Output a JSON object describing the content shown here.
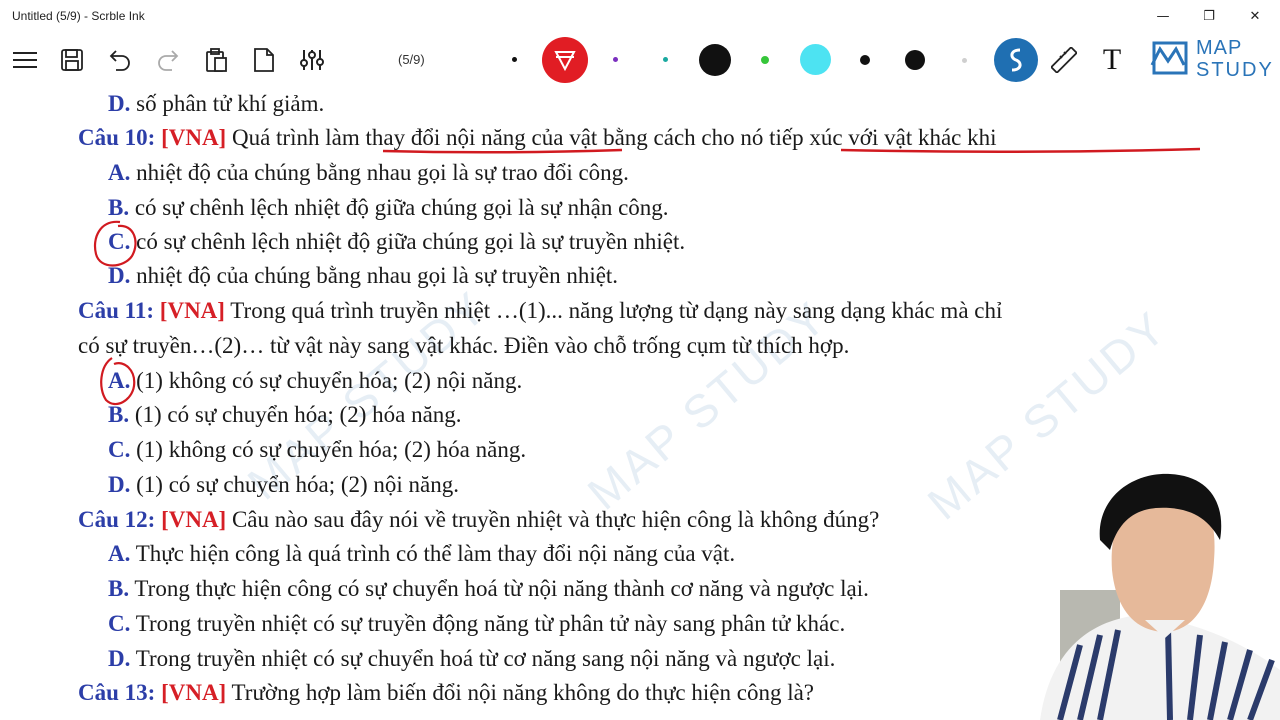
{
  "window": {
    "title": "Untitled (5/9) - Scrble Ink"
  },
  "window_controls": {
    "minimize": "—",
    "maximize": "❐",
    "close": "✕"
  },
  "toolbar": {
    "page_indicator": "(5/9)",
    "text_tool": "T",
    "colors": {
      "red": "#e11d24",
      "purple": "#7b2fbf",
      "teal": "#1aa9a0",
      "black": "#111111",
      "green": "#36c63a",
      "cyan": "#4de3f2",
      "gray": "#cfcfcf",
      "brand_blue": "#1f6fb2"
    }
  },
  "logo": {
    "line1": "MAP",
    "line2": "STUDY"
  },
  "watermark": "MAP STUDY",
  "doc": {
    "prev_d": {
      "label": "D.",
      "text": " số phân tử khí giảm."
    },
    "q10": {
      "label": "Câu 10:",
      "tag": "[VNA]",
      "text": " Quá trình làm thay đổi nội năng của vật bằng cách cho nó tiếp xúc với vật khác khi",
      "options": [
        {
          "label": "A.",
          "text": " nhiệt độ của chúng bằng nhau gọi là sự trao đổi công."
        },
        {
          "label": "B.",
          "text": " có sự chênh lệch nhiệt độ giữa chúng gọi là sự nhận công."
        },
        {
          "label": "C.",
          "text": " có sự chênh lệch nhiệt độ giữa chúng gọi là sự truyền nhiệt."
        },
        {
          "label": "D.",
          "text": " nhiệt độ của chúng bằng nhau gọi là sự truyền nhiệt."
        }
      ]
    },
    "q11": {
      "label": "Câu 11:",
      "tag": "[VNA]",
      "text": " Trong quá trình truyền nhiệt …(1)... năng lượng từ dạng này sang dạng khác mà chỉ",
      "text2": "có sự truyền…(2)… từ vật này sang vật khác. Điền vào chỗ trống cụm từ thích hợp.",
      "options": [
        {
          "label": "A.",
          "text": " (1) không có sự chuyển hóa; (2) nội năng."
        },
        {
          "label": "B.",
          "text": " (1) có sự chuyển hóa; (2) hóa năng."
        },
        {
          "label": "C.",
          "text": " (1) không có sự chuyển hóa; (2) hóa năng."
        },
        {
          "label": "D.",
          "text": " (1) có sự chuyển hóa; (2) nội năng."
        }
      ]
    },
    "q12": {
      "label": "Câu 12:",
      "tag": "[VNA]",
      "text": " Câu nào sau đây nói về truyền nhiệt và thực hiện công là không đúng?",
      "options": [
        {
          "label": "A.",
          "text": " Thực hiện công là quá trình có thể làm thay đổi nội năng của vật."
        },
        {
          "label": "B.",
          "text": " Trong thực hiện công có sự chuyển hoá từ nội năng thành cơ năng và ngược lại."
        },
        {
          "label": "C.",
          "text": " Trong truyền nhiệt có sự truyền động năng từ phân tử này sang phân tử khác."
        },
        {
          "label": "D.",
          "text": " Trong truyền nhiệt có sự chuyển hoá từ cơ năng sang nội năng và ngược lại."
        }
      ]
    },
    "q13": {
      "label": "Câu 13:",
      "tag": "[VNA]",
      "text": " Trường hợp làm biến đổi nội năng không do thực hiện công là?"
    }
  }
}
